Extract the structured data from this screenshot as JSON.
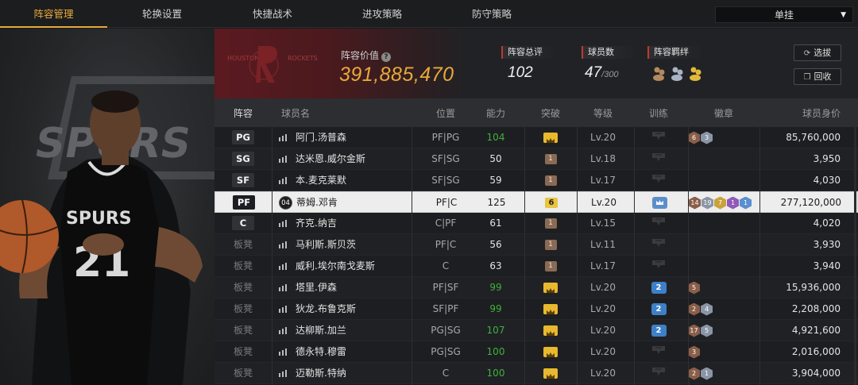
{
  "nav": {
    "tabs": [
      "阵容管理",
      "轮换设置",
      "快捷战术",
      "进攻策略",
      "防守策略"
    ],
    "active_index": 0,
    "mode": "单挂"
  },
  "player": {
    "team_text": "SPURS",
    "jersey_number": "21"
  },
  "header": {
    "team_text_left": "HOUSTON",
    "team_text_right": "ROCKETS",
    "value_label": "阵容价值",
    "value": "391,885,470",
    "rating_label": "阵容总评",
    "rating": "102",
    "count_label": "球员数",
    "count": "47",
    "count_max": "/300",
    "bond_label": "阵容羁绊",
    "select_button": "选拔",
    "recycle_button": "回收"
  },
  "table": {
    "headers": {
      "pos": "阵容",
      "name": "球员名",
      "role": "位置",
      "ability": "能力",
      "breakthrough": "突破",
      "level": "等级",
      "training": "训练",
      "badge": "徽章",
      "price": "球员身价"
    },
    "rows": [
      {
        "pos": "PG",
        "starter": true,
        "num": "",
        "name": "阿门.汤普森",
        "role": "PF|PG",
        "ability": "104",
        "green": true,
        "brk": "crown",
        "level": "Lv.20",
        "trn": "cloud",
        "badges": [
          {
            "c": "br",
            "t": "6"
          },
          {
            "c": "sv",
            "t": "3"
          }
        ],
        "price": "85,760,000"
      },
      {
        "pos": "SG",
        "starter": true,
        "num": "",
        "name": "达米恩.威尔金斯",
        "role": "SF|SG",
        "ability": "50",
        "green": false,
        "brk": "1",
        "level": "Lv.18",
        "trn": "cloud",
        "badges": [],
        "price": "3,950"
      },
      {
        "pos": "SF",
        "starter": true,
        "num": "",
        "name": "本.麦克莱默",
        "role": "SF|SG",
        "ability": "59",
        "green": false,
        "brk": "1",
        "level": "Lv.17",
        "trn": "cloud",
        "badges": [],
        "price": "4,030"
      },
      {
        "pos": "PF",
        "starter": true,
        "num": "04",
        "name": "蒂姆.邓肯",
        "role": "PF|C",
        "ability": "125",
        "green": false,
        "brk": "6",
        "level": "Lv.20",
        "trn": "crown",
        "badges": [
          {
            "c": "br",
            "t": "14"
          },
          {
            "c": "sv",
            "t": "19"
          },
          {
            "c": "gd",
            "t": "7"
          },
          {
            "c": "pu",
            "t": "1"
          },
          {
            "c": "bl",
            "t": "1"
          }
        ],
        "price": "277,120,000"
      },
      {
        "pos": "C",
        "starter": true,
        "num": "",
        "name": "齐克.纳吉",
        "role": "C|PF",
        "ability": "61",
        "green": false,
        "brk": "1",
        "level": "Lv.15",
        "trn": "cloud",
        "badges": [],
        "price": "4,020"
      },
      {
        "pos": "板凳",
        "starter": false,
        "num": "",
        "name": "马利斯.斯贝茨",
        "role": "PF|C",
        "ability": "56",
        "green": false,
        "brk": "1",
        "level": "Lv.11",
        "trn": "cloud",
        "badges": [],
        "price": "3,930"
      },
      {
        "pos": "板凳",
        "starter": false,
        "num": "",
        "name": "威利.埃尔南戈麦斯",
        "role": "C",
        "ability": "63",
        "green": false,
        "brk": "1",
        "level": "Lv.17",
        "trn": "cloud",
        "badges": [],
        "price": "3,940"
      },
      {
        "pos": "板凳",
        "starter": false,
        "num": "",
        "name": "塔里.伊森",
        "role": "PF|SF",
        "ability": "99",
        "green": true,
        "brk": "crown",
        "level": "Lv.20",
        "trn": "2",
        "badges": [
          {
            "c": "br",
            "t": "5"
          }
        ],
        "price": "15,936,000"
      },
      {
        "pos": "板凳",
        "starter": false,
        "num": "",
        "name": "狄龙.布鲁克斯",
        "role": "SF|PF",
        "ability": "99",
        "green": true,
        "brk": "crown",
        "level": "Lv.20",
        "trn": "2",
        "badges": [
          {
            "c": "br",
            "t": "2"
          },
          {
            "c": "sv",
            "t": "4"
          }
        ],
        "price": "2,208,000"
      },
      {
        "pos": "板凳",
        "starter": false,
        "num": "",
        "name": "达柳斯.加兰",
        "role": "PG|SG",
        "ability": "107",
        "green": true,
        "brk": "crown",
        "level": "Lv.20",
        "trn": "2",
        "badges": [
          {
            "c": "br",
            "t": "17"
          },
          {
            "c": "sv",
            "t": "5"
          }
        ],
        "price": "4,921,600"
      },
      {
        "pos": "板凳",
        "starter": false,
        "num": "",
        "name": "德永特.穆雷",
        "role": "PG|SG",
        "ability": "100",
        "green": true,
        "brk": "crown",
        "level": "Lv.20",
        "trn": "cloud",
        "badges": [
          {
            "c": "br",
            "t": "3"
          }
        ],
        "price": "2,016,000"
      },
      {
        "pos": "板凳",
        "starter": false,
        "num": "",
        "name": "迈勒斯.特纳",
        "role": "C",
        "ability": "100",
        "green": true,
        "brk": "crown",
        "level": "Lv.20",
        "trn": "cloud",
        "badges": [
          {
            "c": "br",
            "t": "2"
          },
          {
            "c": "sv",
            "t": "1"
          }
        ],
        "price": "3,904,000"
      }
    ],
    "selected_index": 3
  }
}
